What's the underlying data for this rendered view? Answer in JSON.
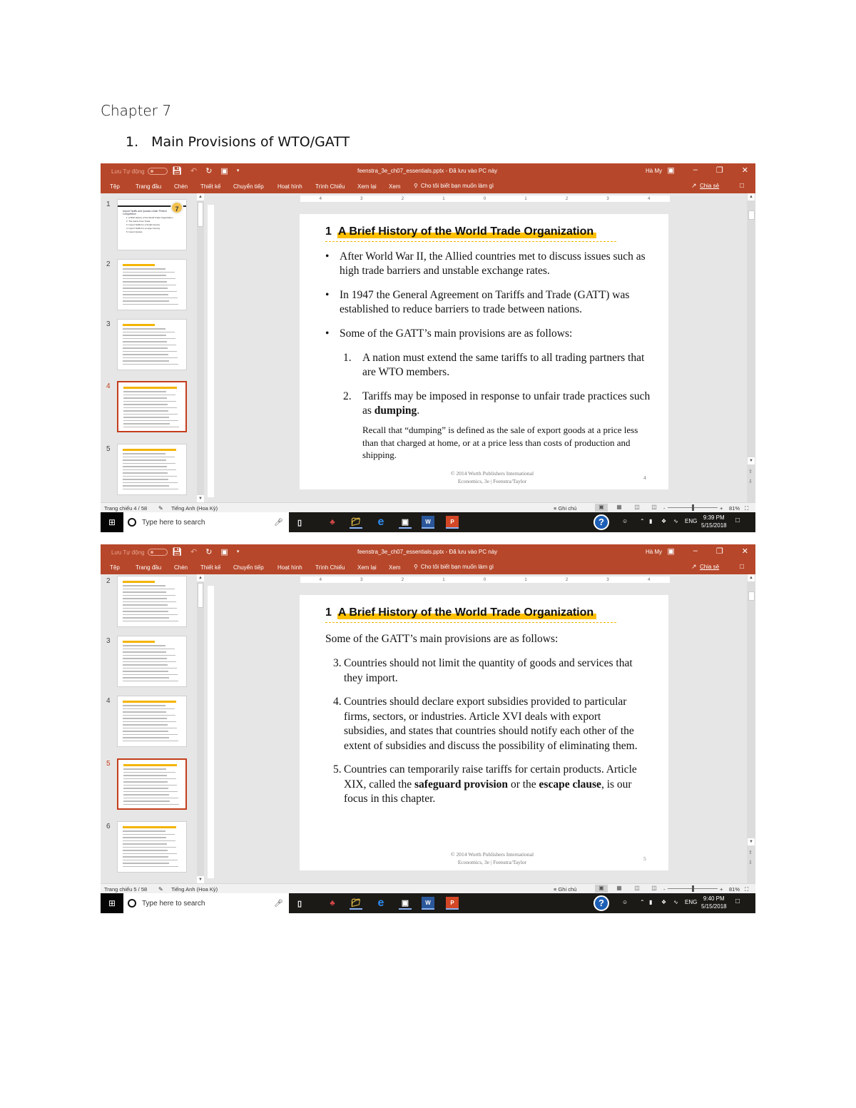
{
  "document": {
    "title": "Chapter 7",
    "heading_number": "1.",
    "heading_text": "Main Provisions of WTO/GATT"
  },
  "app": {
    "autosave_label": "Lưu Tự động",
    "filename": "feenstra_3e_ch07_essentials.pptx  -  Đã lưu vào PC này",
    "user": "Hà My",
    "ribbon_tabs": [
      "Tệp",
      "Trang đầu",
      "Chèn",
      "Thiết kế",
      "Chuyển tiếp",
      "Hoạt hình",
      "Trình Chiếu",
      "Xem lại",
      "Xem"
    ],
    "tell_me": "Cho tôi biết bạn muốn làm gì",
    "share": "Chia sẻ",
    "ruler_labels": [
      "4",
      "3",
      "2",
      "1",
      "0",
      "1",
      "2",
      "3",
      "4"
    ],
    "language": "Tiếng Anh (Hoa Kỳ)",
    "notes_label": "Ghi chú",
    "zoom": "81%",
    "icons": {
      "save": "save-icon",
      "undo": "undo-icon",
      "redo": "redo-icon",
      "present": "present-icon",
      "customize": "chevron-down-icon",
      "ribbon_display": "ribbon-display-icon",
      "minimize": "minimize-icon",
      "restore": "restore-icon",
      "close": "close-icon",
      "search": "search-icon",
      "share": "share-icon",
      "comment": "comment-icon"
    }
  },
  "taskbar": {
    "search_placeholder": "Type here to search",
    "language": "ENG",
    "date": "5/15/2018"
  },
  "screenshots": [
    {
      "slide_status": "Trang chiếu 4 / 58",
      "time": "9:39 PM",
      "thumbnails": [
        {
          "number": "1",
          "active": false
        },
        {
          "number": "2",
          "active": false
        },
        {
          "number": "3",
          "active": false
        },
        {
          "number": "4",
          "active": true
        },
        {
          "number": "5",
          "active": false
        }
      ],
      "thumbnail1": {
        "badge": "7",
        "title": "Import Tariffs and Quotas Under Perfect Competition",
        "items": [
          "1. A Brief History of the World Trade Organization",
          "2. The Gains From Trade",
          "3. Import Tariffs for a Small Country",
          "4. Import Tariffs for a Large Country",
          "5. Import Quotas"
        ]
      },
      "slide": {
        "title_num": "1",
        "title": "A Brief History of the World Trade Organization",
        "bullets": [
          "After World War II, the Allied countries met to discuss issues such as high trade barriers and unstable exchange rates.",
          "In 1947 the General Agreement on Tariffs and Trade (GATT) was established to reduce barriers to trade between nations.",
          "Some of the GATT’s main provisions are as follows:"
        ],
        "items": [
          {
            "n": "1.",
            "text": "A nation must extend the same tariffs to all trading partners that are WTO members."
          },
          {
            "n": "2.",
            "text_before": "Tariffs may be imposed in response to unfair trade practices such as ",
            "bold": "dumping",
            "text_after": "."
          }
        ],
        "recall": "Recall that “dumping” is defined as the sale of export goods at a price less than that charged at home, or at a price less than costs of production and shipping.",
        "footer_line1": "© 2014 Worth Publishers   International",
        "footer_line2": "Economics, 3e  |  Feenstra/Taylor",
        "page": "4"
      }
    },
    {
      "slide_status": "Trang chiếu 5 / 58",
      "time": "9:40 PM",
      "thumbnails": [
        {
          "number": "2",
          "active": false
        },
        {
          "number": "3",
          "active": false
        },
        {
          "number": "4",
          "active": false
        },
        {
          "number": "5",
          "active": true
        },
        {
          "number": "6",
          "active": false
        }
      ],
      "slide": {
        "title_num": "1",
        "title": "A Brief History of the World Trade Organization",
        "intro": "Some of the GATT’s main provisions are as follows:",
        "items": [
          {
            "n": "3.",
            "text": "Countries should not limit the quantity of goods and services that they import."
          },
          {
            "n": "4.",
            "text": "Countries should declare export subsidies provided to particular firms, sectors, or industries. Article XVI deals with export subsidies, and states that countries should notify each other of the extent of subsidies and discuss the possibility of eliminating them."
          },
          {
            "n": "5.",
            "t1": "Countries can temporarily raise tariffs for certain products. Article XIX, called the ",
            "b1": "safeguard provision",
            "t2": " or the ",
            "b2": "escape clause",
            "t3": ", is our focus in this chapter."
          }
        ],
        "footer_line1": "© 2014 Worth Publishers   International",
        "footer_line2": "Economics, 3e  |  Feenstra/Taylor",
        "page": "5"
      }
    }
  ]
}
